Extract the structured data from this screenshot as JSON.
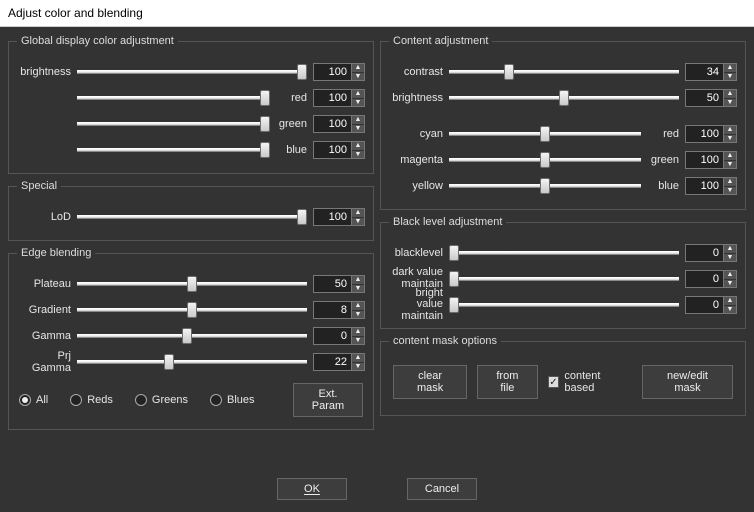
{
  "window": {
    "title": "Adjust color and blending"
  },
  "global": {
    "legend": "Global display color adjustment",
    "brightness": {
      "label": "brightness",
      "value": 100,
      "pos": 100
    },
    "red": {
      "label": "red",
      "value": 100,
      "pos": 100
    },
    "green": {
      "label": "green",
      "value": 100,
      "pos": 100
    },
    "blue": {
      "label": "blue",
      "value": 100,
      "pos": 100
    }
  },
  "special": {
    "legend": "Special",
    "lod": {
      "label": "LoD",
      "value": 100,
      "pos": 100
    }
  },
  "edge": {
    "legend": "Edge blending",
    "plateau": {
      "label": "Plateau",
      "value": 50,
      "pos": 50
    },
    "gradient": {
      "label": "Gradient",
      "value": 8,
      "pos": 50
    },
    "gamma": {
      "label": "Gamma",
      "value": 0,
      "pos": 48
    },
    "prjgamma": {
      "label": "Prj Gamma",
      "value": 22,
      "pos": 40
    },
    "radios": {
      "all": "All",
      "reds": "Reds",
      "greens": "Greens",
      "blues": "Blues",
      "selected": "all"
    },
    "ext_param": "Ext. Param"
  },
  "content": {
    "legend": "Content adjustment",
    "contrast": {
      "label": "contrast",
      "value": 34,
      "pos": 26
    },
    "brightness": {
      "label": "brightness",
      "value": 50,
      "pos": 50
    },
    "cyan": {
      "label": "cyan",
      "rlabel": "red",
      "value": 100,
      "pos": 50
    },
    "magenta": {
      "label": "magenta",
      "rlabel": "green",
      "value": 100,
      "pos": 50
    },
    "yellow": {
      "label": "yellow",
      "rlabel": "blue",
      "value": 100,
      "pos": 50
    }
  },
  "black": {
    "legend": "Black level adjustment",
    "blacklevel": {
      "label": "blacklevel",
      "value": 0,
      "pos": 0
    },
    "darkvalue": {
      "label": "dark value maintain",
      "value": 0,
      "pos": 0
    },
    "brightvalue": {
      "label": "bright value maintain",
      "value": 0,
      "pos": 0
    }
  },
  "mask": {
    "legend": "content mask options",
    "clear": "clear mask",
    "fromfile": "from file",
    "content_based": {
      "label": "content based",
      "checked": true
    },
    "new_edit": "new/edit mask"
  },
  "footer": {
    "ok": "OK",
    "cancel": "Cancel"
  }
}
